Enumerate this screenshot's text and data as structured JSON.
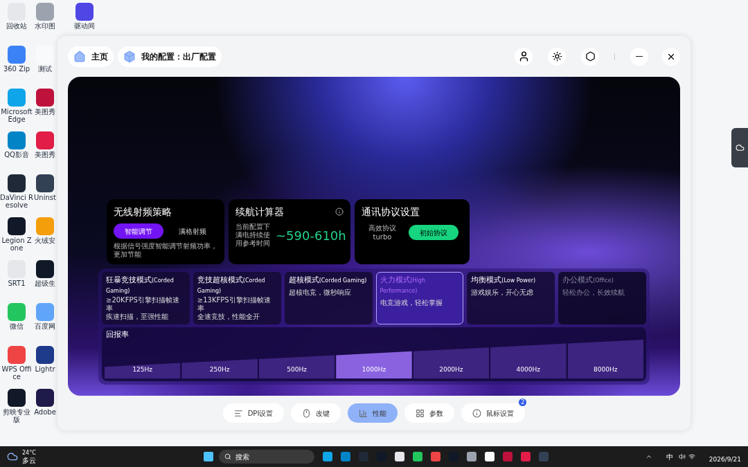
{
  "desktop": {
    "columns": [
      [
        {
          "label": "回收站"
        },
        {
          "label": "360 Zip"
        },
        {
          "label": "Microsoft Edge"
        },
        {
          "label": "QQ影音"
        },
        {
          "label": "DaVinci Resolve"
        },
        {
          "label": "Legion Zone"
        },
        {
          "label": "SRT1"
        },
        {
          "label": "微信"
        },
        {
          "label": "WPS Office"
        },
        {
          "label": "剪映专业版"
        }
      ],
      [
        {
          "label": "水印图"
        },
        {
          "label": "测试"
        },
        {
          "label": "美图秀"
        },
        {
          "label": "美图秀"
        },
        {
          "label": "Uninst"
        },
        {
          "label": "火绒安"
        },
        {
          "label": "超级生"
        },
        {
          "label": "百度网"
        },
        {
          "label": "Lightr"
        },
        {
          "label": "Adobe"
        }
      ],
      [
        {
          "label": "驱动间"
        }
      ]
    ]
  },
  "window": {
    "tabs": [
      {
        "label": "主页",
        "kind": "home"
      },
      {
        "label": "我的配置：出厂配置",
        "kind": "config"
      }
    ]
  },
  "wireless": {
    "title": "无线射频策略",
    "options": [
      {
        "label": "智能调节",
        "selected": true
      },
      {
        "label": "满格射频",
        "selected": false
      }
    ],
    "note": "根据信号强度智能调节射频功率，更加节能"
  },
  "battery": {
    "title": "续航计算器",
    "caption": "当前配置下满电持续使用参考时间",
    "value": "~590-610h"
  },
  "protocol": {
    "title": "通讯协议设置",
    "label": "高效协议",
    "value": "turbo",
    "button": "初始协议"
  },
  "modes": [
    {
      "name": "狂暴竞技模式",
      "tag": "(Corded Gaming)",
      "lines": [
        "≥20KFPS引擎扫描帧速率",
        "疾速扫描，至强性能"
      ],
      "selected": false,
      "disabled": false
    },
    {
      "name": "竞技超核模式",
      "tag": "(Corded Gaming)",
      "lines": [
        "≥13KFPS引擎扫描帧速率",
        "全速竞技，性能全开"
      ],
      "selected": false,
      "disabled": false
    },
    {
      "name": "超核模式",
      "tag": "(Corded Gaming)",
      "lines": [
        "超核电竞，微秒响应"
      ],
      "selected": false,
      "disabled": false
    },
    {
      "name": "火力模式",
      "tag": "(High Performance)",
      "lines": [
        "电竞游戏，轻松掌握"
      ],
      "selected": true,
      "disabled": false
    },
    {
      "name": "均衡模式",
      "tag": "(Low Power)",
      "lines": [
        "游戏娱乐，开心无虑"
      ],
      "selected": false,
      "disabled": false
    },
    {
      "name": "办公模式",
      "tag": "(Office)",
      "lines": [
        "轻松办公，长效续航"
      ],
      "selected": false,
      "disabled": true
    }
  ],
  "polling": {
    "title": "回报率",
    "rates": [
      {
        "label": "125Hz",
        "selected": false
      },
      {
        "label": "250Hz",
        "selected": false
      },
      {
        "label": "500Hz",
        "selected": false
      },
      {
        "label": "1000Hz",
        "selected": true
      },
      {
        "label": "2000Hz",
        "selected": false
      },
      {
        "label": "4000Hz",
        "selected": false
      },
      {
        "label": "8000Hz",
        "selected": false
      }
    ]
  },
  "nav": [
    {
      "label": "DPI设置",
      "kind": "dpi",
      "selected": false
    },
    {
      "label": "改键",
      "kind": "mouse",
      "selected": false
    },
    {
      "label": "性能",
      "kind": "perf",
      "selected": true
    },
    {
      "label": "参数",
      "kind": "grid",
      "selected": false
    },
    {
      "label": "鼠标设置",
      "kind": "info",
      "selected": false,
      "badge": "2"
    }
  ],
  "taskbar": {
    "temperature": "24°C",
    "weather": "多云",
    "search": "搜索",
    "ime": "中",
    "date": "2026/9/21"
  }
}
